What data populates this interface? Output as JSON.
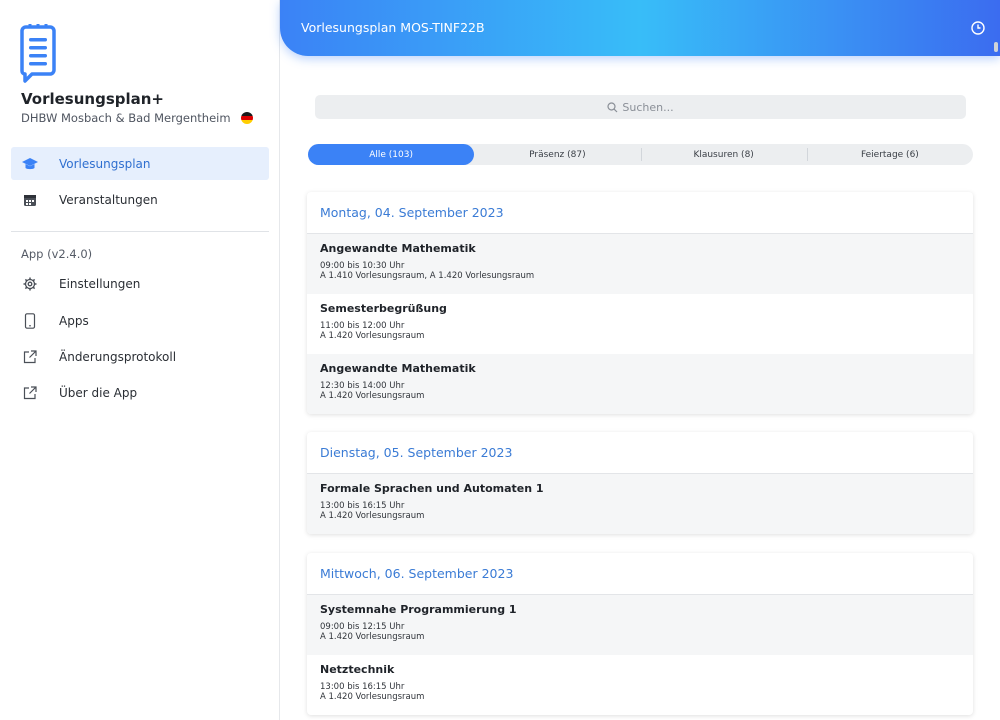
{
  "sidebar": {
    "app_name": "Vorlesungsplan+",
    "subtitle": "DHBW Mosbach & Bad Mergentheim",
    "nav": [
      {
        "label": "Vorlesungsplan",
        "icon": "graduation-cap-icon"
      },
      {
        "label": "Veranstaltungen",
        "icon": "calendar-icon"
      }
    ],
    "section_label": "App (v2.4.0)",
    "app_items": [
      {
        "label": "Einstellungen",
        "icon": "gear-icon"
      },
      {
        "label": "Apps",
        "icon": "smartphone-icon"
      },
      {
        "label": "Änderungsprotokoll",
        "icon": "external-link-icon"
      },
      {
        "label": "Über die App",
        "icon": "external-link-icon"
      }
    ]
  },
  "header": {
    "title": "Vorlesungsplan MOS-TINF22B"
  },
  "search": {
    "placeholder": "Suchen..."
  },
  "filters": [
    "Alle (103)",
    "Präsenz (87)",
    "Klausuren (8)",
    "Feiertage (6)"
  ],
  "days": [
    {
      "date": "Montag, 04. September 2023",
      "events": [
        {
          "title": "Angewandte Mathematik",
          "time": "09:00 bis 10:30 Uhr",
          "room": "A 1.410 Vorlesungsraum, A 1.420 Vorlesungsraum"
        },
        {
          "title": "Semesterbegrüßung",
          "time": "11:00 bis 12:00 Uhr",
          "room": "A 1.420 Vorlesungsraum"
        },
        {
          "title": "Angewandte Mathematik",
          "time": "12:30 bis 14:00 Uhr",
          "room": "A 1.420 Vorlesungsraum"
        }
      ]
    },
    {
      "date": "Dienstag, 05. September 2023",
      "events": [
        {
          "title": "Formale Sprachen und Automaten 1",
          "time": "13:00 bis 16:15 Uhr",
          "room": "A 1.420 Vorlesungsraum"
        }
      ]
    },
    {
      "date": "Mittwoch, 06. September 2023",
      "events": [
        {
          "title": "Systemnahe Programmierung 1",
          "time": "09:00 bis 12:15 Uhr",
          "room": "A 1.420 Vorlesungsraum"
        },
        {
          "title": "Netztechnik",
          "time": "13:00 bis 16:15 Uhr",
          "room": "A 1.420 Vorlesungsraum"
        }
      ]
    }
  ],
  "colors": {
    "accent": "#3b82f6",
    "date_text": "#3a7bd5",
    "active_nav_bg": "#e6effd"
  }
}
